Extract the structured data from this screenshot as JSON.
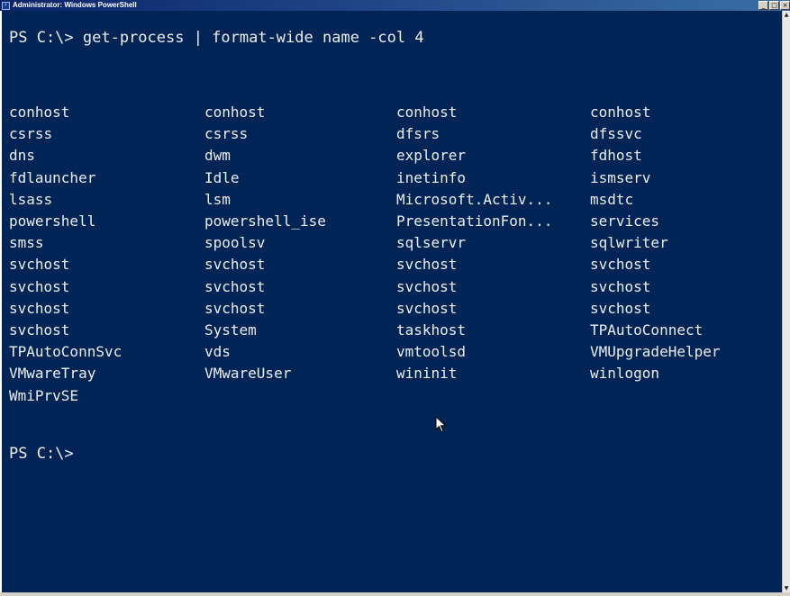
{
  "window": {
    "title": "Administrator: Windows PowerShell",
    "buttons": {
      "minimize": "_",
      "maximize": "□",
      "close": "×"
    }
  },
  "console": {
    "command_line": "PS C:\\> get-process | format-wide name -col 4",
    "processes": [
      [
        "conhost",
        "conhost",
        "conhost",
        "conhost"
      ],
      [
        "csrss",
        "csrss",
        "dfsrs",
        "dfssvc"
      ],
      [
        "dns",
        "dwm",
        "explorer",
        "fdhost"
      ],
      [
        "fdlauncher",
        "Idle",
        "inetinfo",
        "ismserv"
      ],
      [
        "lsass",
        "lsm",
        "Microsoft.Activ...",
        "msdtc"
      ],
      [
        "powershell",
        "powershell_ise",
        "PresentationFon...",
        "services"
      ],
      [
        "smss",
        "spoolsv",
        "sqlservr",
        "sqlwriter"
      ],
      [
        "svchost",
        "svchost",
        "svchost",
        "svchost"
      ],
      [
        "svchost",
        "svchost",
        "svchost",
        "svchost"
      ],
      [
        "svchost",
        "svchost",
        "svchost",
        "svchost"
      ],
      [
        "svchost",
        "System",
        "taskhost",
        "TPAutoConnect"
      ],
      [
        "TPAutoConnSvc",
        "vds",
        "vmtoolsd",
        "VMUpgradeHelper"
      ],
      [
        "VMwareTray",
        "VMwareUser",
        "wininit",
        "winlogon"
      ],
      [
        "WmiPrvSE",
        "",
        "",
        ""
      ]
    ],
    "prompt": "PS C:\\>"
  },
  "colors": {
    "console_background": "#012456",
    "console_text": "#eeedf0",
    "titlebar_start": "#0a246a",
    "titlebar_end": "#3a6ea5"
  },
  "icons": {
    "window_icon": "powershell-icon",
    "pointer": "mouse-pointer-icon"
  }
}
